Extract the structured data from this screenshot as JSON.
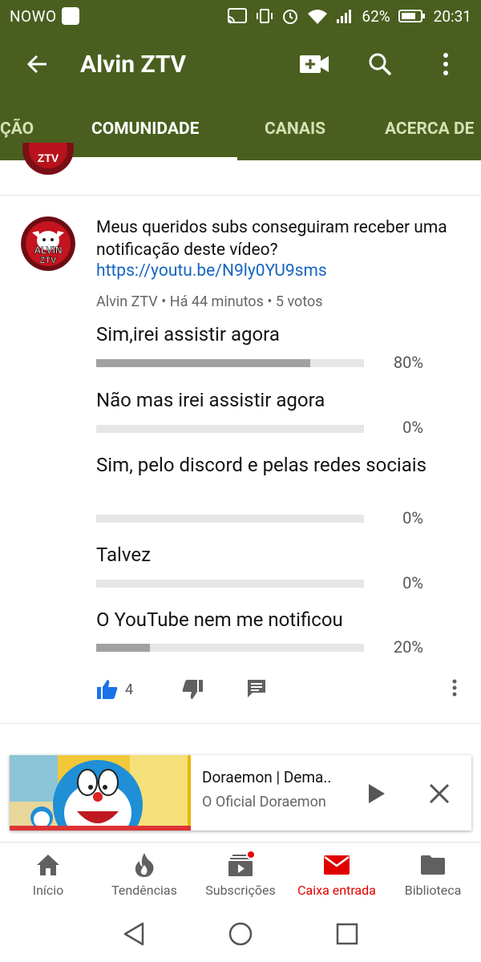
{
  "status_bar": {
    "carrier": "NOWO",
    "battery": "62%",
    "time": "20:31"
  },
  "app_bar": {
    "title": "Alvin ZTV",
    "icons": [
      "back-arrow-icon",
      "video-camera-add-icon",
      "search-icon",
      "more-vert-icon"
    ]
  },
  "tabs": [
    {
      "label": "ÇÃO",
      "active": false
    },
    {
      "label": "COMUNIDADE",
      "active": true
    },
    {
      "label": "CANAIS",
      "active": false
    },
    {
      "label": "ACERCA DE",
      "active": false
    }
  ],
  "post": {
    "text": "Meus queridos subs conseguiram receber uma notificação deste vídeo?",
    "link": "https://youtu.be/N9ly0YU9sms",
    "author": "Alvin ZTV",
    "time": "Há 44 minutos",
    "votes": "5 votos",
    "avatar_text": "ALVIN ZTV",
    "poll": [
      {
        "label": "Sim,irei assistir agora",
        "percent_label": "80%",
        "fraction": 0.8
      },
      {
        "label": "Não mas irei assistir agora",
        "percent_label": "0%",
        "fraction": 0.0
      },
      {
        "label": "Sim, pelo discord e pelas redes sociais",
        "percent_label": "0%",
        "fraction": 0.0
      },
      {
        "label": "Talvez",
        "percent_label": "0%",
        "fraction": 0.0
      },
      {
        "label": "O YouTube nem me notificou",
        "percent_label": "20%",
        "fraction": 0.2
      }
    ],
    "likes": "4"
  },
  "mini_player": {
    "title": "Doraemon | Dema..",
    "channel": "O Oficial Doraemon"
  },
  "bottom_nav": [
    {
      "label": "Início",
      "icon": "home-icon",
      "active": false
    },
    {
      "label": "Tendências",
      "icon": "fire-icon",
      "active": false
    },
    {
      "label": "Subscrições",
      "icon": "subscriptions-icon",
      "active": false
    },
    {
      "label": "Caixa entrada",
      "icon": "mail-icon",
      "active": true
    },
    {
      "label": "Biblioteca",
      "icon": "folder-icon",
      "active": false
    }
  ],
  "colors": {
    "app_bar": "#4a5f1f",
    "link": "#1565c0",
    "like": "#1a73e8",
    "active_nav": "#e00000"
  }
}
